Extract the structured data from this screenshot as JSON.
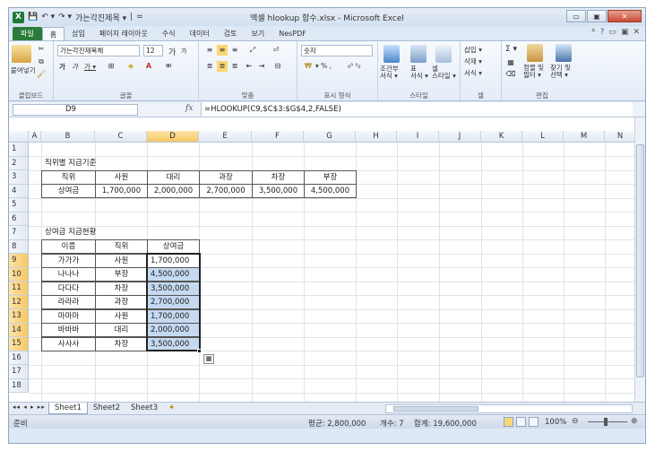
{
  "window": {
    "title": "엑셀 hlookup 함수.xlsx - Microsoft Excel",
    "logo": "X",
    "quick_access": [
      "💾",
      "↶ ▾",
      "↷ ▾",
      "가는각진제목 ▾",
      "|",
      "="
    ],
    "controls": {
      "minimize": "▭",
      "restore": "▣",
      "close": "✕"
    }
  },
  "ribbon_tabs": [
    "파일",
    "홈",
    "삽입",
    "페이지 레이아웃",
    "수식",
    "데이터",
    "검토",
    "보기",
    "NesPDF"
  ],
  "ribbon_right": [
    "ᐞ",
    "?",
    "▭",
    "▣",
    "✕"
  ],
  "ribbon": {
    "clipboard": {
      "paste": "붙여넣기",
      "label": "클립보드"
    },
    "font": {
      "name": "가는각진제목체",
      "size": "12",
      "grow": "가",
      "shrink": "가",
      "bold": "가",
      "italic": "가",
      "underline": "가 ▾",
      "label": "글꼴"
    },
    "alignment": {
      "label": "맞춤"
    },
    "number": {
      "format": "숫자",
      "label": "표시 형식",
      "buttons": "▾ % ,",
      "decimals": "₀⁰ ⁰₀"
    },
    "styles": {
      "cond": "조건부\n서식 ▾",
      "table": "표\n서식 ▾",
      "cell": "셀\n스타일 ▾",
      "label": "스타일"
    },
    "cells": {
      "insert": "삽입 ▾",
      "delete": "삭제 ▾",
      "format": "서식 ▾",
      "label": "셀"
    },
    "editing": {
      "sum": "Σ ▾",
      "sort": "정렬 및\n필터 ▾",
      "find": "찾기 및\n선택 ▾",
      "label": "편집"
    }
  },
  "formula_bar": {
    "name_box": "D9",
    "fx": "fx",
    "formula": "=HLOOKUP(C9,$C$3:$G$4,2,FALSE)"
  },
  "columns": [
    "A",
    "B",
    "C",
    "D",
    "E",
    "F",
    "G",
    "H",
    "I",
    "J",
    "K",
    "L",
    "M",
    "N"
  ],
  "rows": [
    "1",
    "2",
    "3",
    "4",
    "5",
    "6",
    "7",
    "8",
    "9",
    "10",
    "11",
    "12",
    "13",
    "14",
    "15",
    "16",
    "17",
    "18"
  ],
  "sheet": {
    "title1": "직위별 지급기준",
    "table1_header": [
      "직위",
      "사원",
      "대리",
      "과장",
      "차장",
      "부장"
    ],
    "table1_row": [
      "상여금",
      "1,700,000",
      "2,000,000",
      "2,700,000",
      "3,500,000",
      "4,500,000"
    ],
    "title2": "상여금 지급현황",
    "table2_header": [
      "이름",
      "직위",
      "상여금"
    ],
    "table2_rows": [
      [
        "가가가",
        "사원",
        "1,700,000"
      ],
      [
        "나나나",
        "부장",
        "4,500,000"
      ],
      [
        "다다다",
        "차장",
        "3,500,000"
      ],
      [
        "라라라",
        "과장",
        "2,700,000"
      ],
      [
        "마마마",
        "사원",
        "1,700,000"
      ],
      [
        "바바바",
        "대리",
        "2,000,000"
      ],
      [
        "사사사",
        "차장",
        "3,500,000"
      ]
    ]
  },
  "sheet_tabs": [
    "Sheet1",
    "Sheet2",
    "Sheet3"
  ],
  "sheet_nav": "◂◂ ◂ ▸ ▸▸",
  "status": {
    "ready": "준비",
    "average": "평균: 2,800,000",
    "count": "개수: 7",
    "sum": "합계: 19,600,000",
    "zoom": "100%",
    "zoom_out": "⊖",
    "zoom_in": "⊕"
  },
  "colors": {
    "selected_fill": "#c5d9f1",
    "selected_header": "#f6c764",
    "file_tab": "#2a7c3a"
  }
}
